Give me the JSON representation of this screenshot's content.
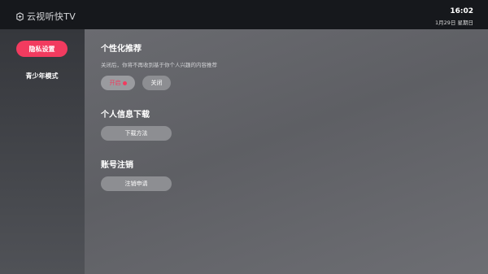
{
  "header": {
    "app_name": "云视听快TV",
    "time": "16:02",
    "date": "1月29日 星期日"
  },
  "sidebar": {
    "items": [
      {
        "label": "隐私设置",
        "active": true
      },
      {
        "label": "青少年模式",
        "active": false
      }
    ]
  },
  "main": {
    "recommend": {
      "title": "个性化推荐",
      "description": "关闭后，你将不再收到基于你个人兴趣的内容推荐",
      "options": [
        {
          "label": "开启",
          "selected": true
        },
        {
          "label": "关闭",
          "selected": false
        }
      ]
    },
    "download": {
      "title": "个人信息下载",
      "button": "下载方法"
    },
    "account": {
      "title": "账号注销",
      "button": "注销申请"
    }
  },
  "colors": {
    "accent": "#f23b5f",
    "topbar": "#16181c"
  }
}
